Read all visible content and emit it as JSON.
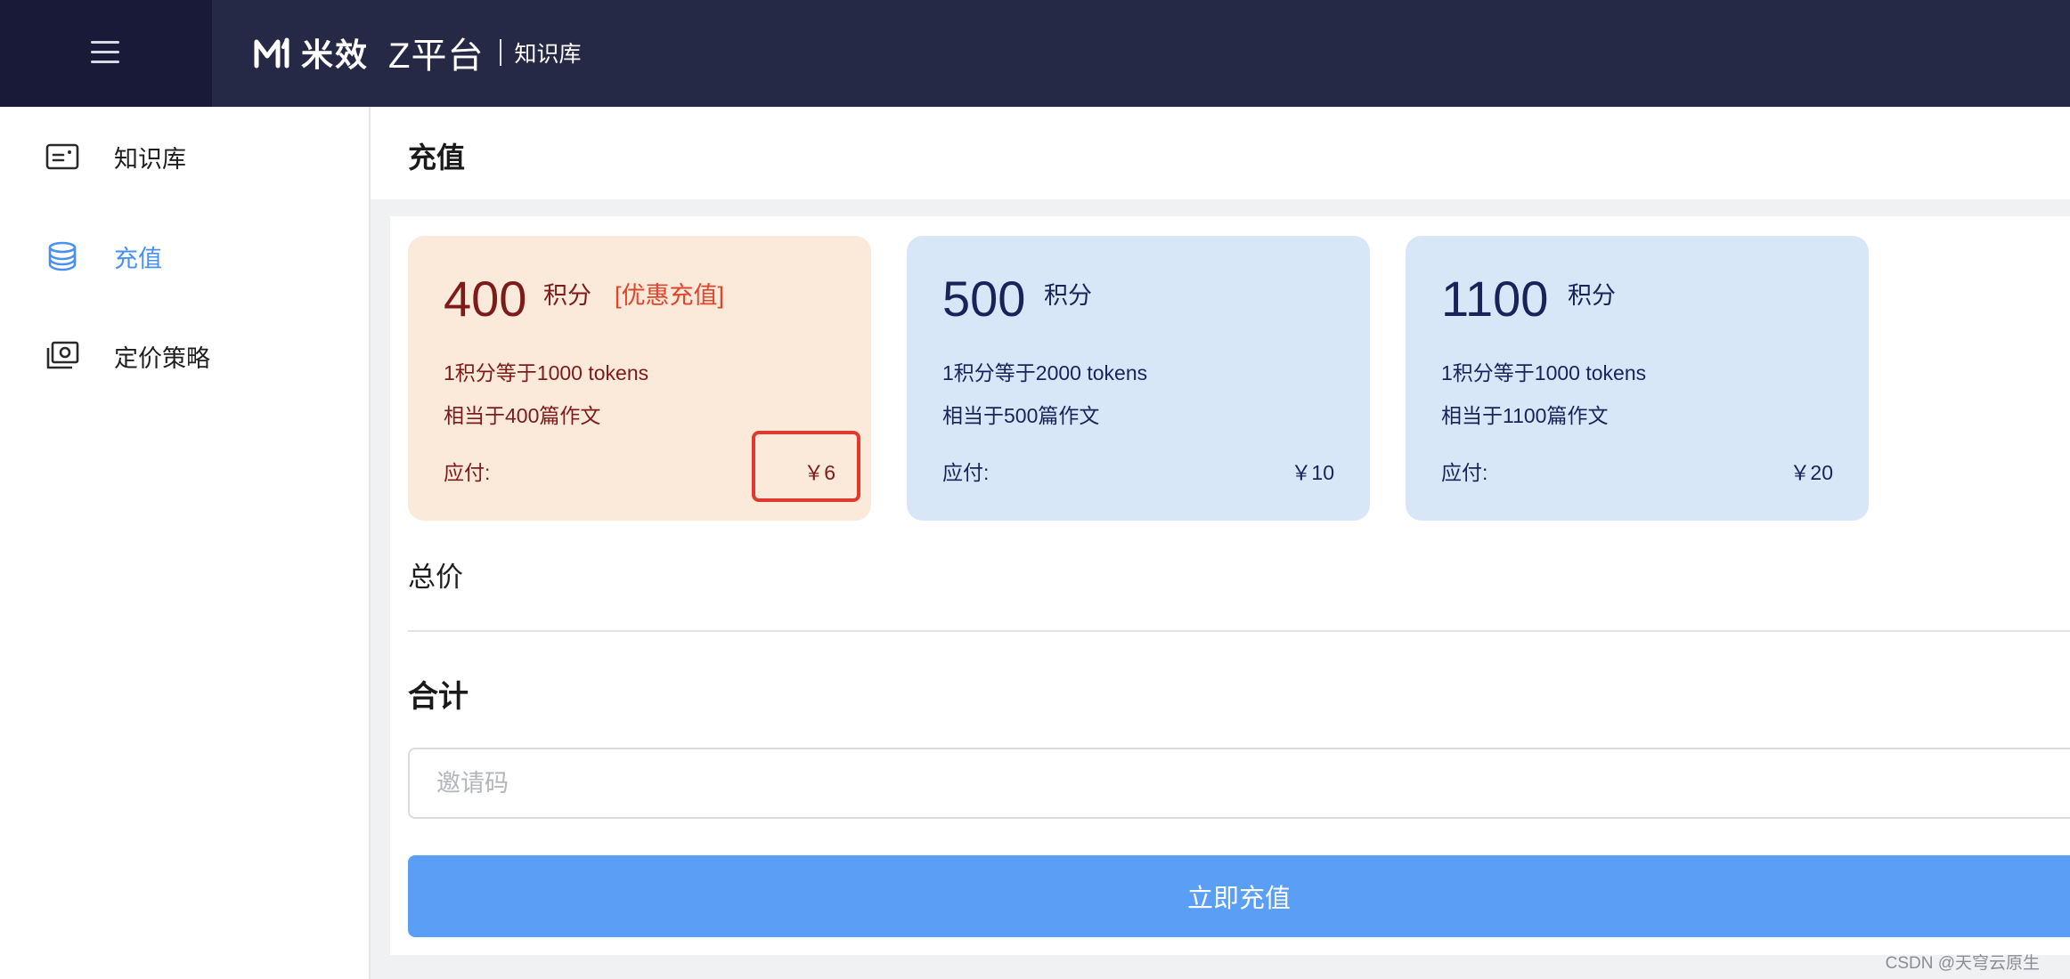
{
  "header": {
    "brand_name": "米效",
    "platform": "Z平台",
    "section": "知识库"
  },
  "sidebar": {
    "items": [
      {
        "label": "知识库",
        "icon": "knowledge-card-icon",
        "active": false
      },
      {
        "label": "充值",
        "icon": "coin-stack-icon",
        "active": true
      },
      {
        "label": "定价策略",
        "icon": "pricing-photo-icon",
        "active": false
      }
    ]
  },
  "main": {
    "title": "充值",
    "plans": [
      {
        "points": "400",
        "unit": "积分",
        "tag": "[优惠充值]",
        "rate": "1积分等于1000 tokens",
        "equivalent": "相当于400篇作文",
        "pay_label": "应付:",
        "price": "￥6",
        "style": "promo"
      },
      {
        "points": "500",
        "unit": "积分",
        "rate": "1积分等于2000 tokens",
        "equivalent": "相当于500篇作文",
        "pay_label": "应付:",
        "price": "￥10",
        "style": "plain"
      },
      {
        "points": "1100",
        "unit": "积分",
        "rate": "1积分等于1000 tokens",
        "equivalent": "相当于1100篇作文",
        "pay_label": "应付:",
        "price": "￥20",
        "style": "plain"
      }
    ],
    "total_label": "总价",
    "sum_label": "合计",
    "invite_placeholder": "邀请码",
    "submit_label": "立即充值"
  },
  "watermark": "CSDN @天穹云原生",
  "colors": {
    "topbar": "#262946",
    "accent": "#4a90f0",
    "button": "#5b9ef6",
    "promo_card": "#fbe9da",
    "plain_card": "#d7e7f8",
    "highlight": "#e03a2e"
  }
}
